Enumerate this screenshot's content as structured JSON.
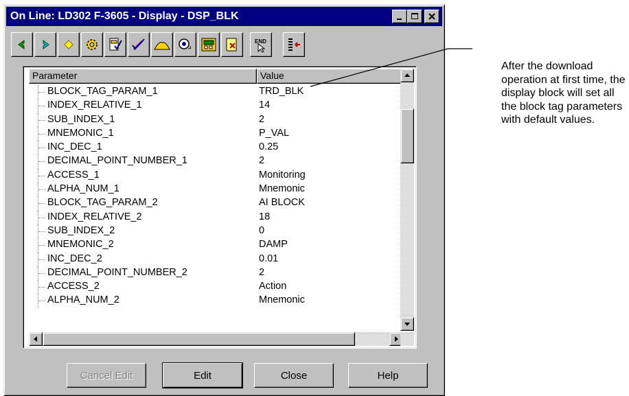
{
  "window": {
    "title": "On Line: LD302 F-3605 - Display - DSP_BLK"
  },
  "toolbar": {
    "buttons": [
      {
        "icon": "left-arrow-icon"
      },
      {
        "icon": "right-arrow-icon"
      },
      {
        "icon": "diamond-icon"
      },
      {
        "icon": "gear-icon"
      },
      {
        "icon": "device-check-icon"
      },
      {
        "icon": "pen-check-icon"
      },
      {
        "icon": "mountain-icon"
      },
      {
        "icon": "tuning-icon"
      },
      {
        "icon": "monitor-icon"
      },
      {
        "icon": "scroll-icon"
      },
      {
        "icon": "end-cursor-icon"
      },
      {
        "icon": "list-arrow-icon"
      }
    ]
  },
  "table": {
    "headers": {
      "parameter": "Parameter",
      "value": "Value"
    },
    "rows": [
      {
        "name": "BLOCK_TAG_PARAM_1",
        "value": "TRD_BLK"
      },
      {
        "name": "INDEX_RELATIVE_1",
        "value": "14"
      },
      {
        "name": "SUB_INDEX_1",
        "value": "2"
      },
      {
        "name": "MNEMONIC_1",
        "value": "P_VAL"
      },
      {
        "name": "INC_DEC_1",
        "value": "0.25"
      },
      {
        "name": "DECIMAL_POINT_NUMBER_1",
        "value": "2"
      },
      {
        "name": "ACCESS_1",
        "value": "Monitoring"
      },
      {
        "name": "ALPHA_NUM_1",
        "value": "Mnemonic"
      },
      {
        "name": "BLOCK_TAG_PARAM_2",
        "value": "AI BLOCK"
      },
      {
        "name": "INDEX_RELATIVE_2",
        "value": "18"
      },
      {
        "name": "SUB_INDEX_2",
        "value": "0"
      },
      {
        "name": "MNEMONIC_2",
        "value": "DAMP"
      },
      {
        "name": "INC_DEC_2",
        "value": "0.01"
      },
      {
        "name": "DECIMAL_POINT_NUMBER_2",
        "value": "2"
      },
      {
        "name": "ACCESS_2",
        "value": "Action"
      },
      {
        "name": "ALPHA_NUM_2",
        "value": "Mnemonic"
      }
    ]
  },
  "buttons": {
    "cancel_edit": "Cancel Edit",
    "edit": "Edit",
    "close": "Close",
    "help": "Help"
  },
  "annotation": {
    "text": "After the download operation at first time, the display block will set all the block tag parameters with default values."
  },
  "colors": {
    "titlebar": "#000080",
    "face": "#c0c0c0",
    "arrow_green": "#00a000",
    "arrow_cyan": "#00c0c0",
    "diamond_yellow": "#ffff00"
  }
}
